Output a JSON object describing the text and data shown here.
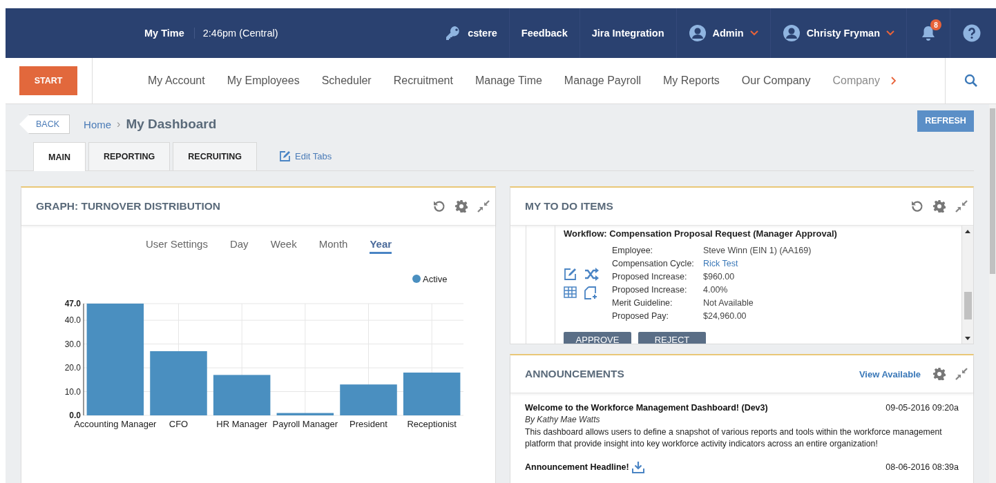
{
  "topbar": {
    "my_time_label": "My Time",
    "time": "2:46pm (Central)",
    "items": [
      {
        "kind": "key",
        "label": "cstere"
      },
      {
        "kind": "plain",
        "label": "Feedback"
      },
      {
        "kind": "plain",
        "label": "Jira Integration"
      },
      {
        "kind": "user",
        "label": "Admin"
      },
      {
        "kind": "user",
        "label": "Christy Fryman"
      }
    ],
    "notification_count": "8"
  },
  "nav": {
    "start": "START",
    "items": [
      "My Account",
      "My Employees",
      "Scheduler",
      "Recruitment",
      "Manage Time",
      "Manage Payroll",
      "My Reports",
      "Our Company",
      "Company"
    ]
  },
  "breadcrumb": {
    "back": "BACK",
    "home": "Home",
    "separator": "›",
    "current": "My Dashboard"
  },
  "refresh": "REFRESH",
  "tabs": [
    {
      "label": "MAIN",
      "selected": true
    },
    {
      "label": "REPORTING",
      "selected": false
    },
    {
      "label": "RECRUITING",
      "selected": false
    }
  ],
  "edit_tabs": "Edit Tabs",
  "turnover": {
    "title": "GRAPH: TURNOVER DISTRIBUTION",
    "periods": [
      {
        "label": "User Settings",
        "selected": false
      },
      {
        "label": "Day",
        "selected": false
      },
      {
        "label": "Week",
        "selected": false
      },
      {
        "label": "Month",
        "selected": false
      },
      {
        "label": "Year",
        "selected": true
      }
    ],
    "chart_data": {
      "type": "bar",
      "categories": [
        "Accounting Manager",
        "CFO",
        "HR Manager",
        "Payroll Manager",
        "President",
        "Receptionist"
      ],
      "series": [
        {
          "name": "Active",
          "color": "#4a8fc0",
          "values": [
            47,
            27,
            17,
            1,
            13,
            18
          ]
        }
      ],
      "ylim": [
        0,
        47
      ],
      "grid": true,
      "yticks": [
        {
          "value": 0,
          "label": "0.0"
        },
        {
          "value": 10,
          "label": "10.0"
        },
        {
          "value": 20,
          "label": "20.0"
        },
        {
          "value": 30,
          "label": "30.0"
        },
        {
          "value": 40,
          "label": "40.0"
        },
        {
          "value": 47,
          "label": "47.0"
        }
      ]
    }
  },
  "todo": {
    "title": "MY TO DO ITEMS",
    "workflow": "Workflow: Compensation Proposal Request (Manager Approval)",
    "fields": [
      {
        "label": "Employee:",
        "value": "Steve Winn (EIN 1) (AA169)",
        "kind": "text"
      },
      {
        "label": "Compensation Cycle:",
        "value": "Rick Test",
        "kind": "link"
      },
      {
        "label": "Proposed Increase:",
        "value": "$960.00",
        "kind": "text"
      },
      {
        "label": "Proposed Increase:",
        "value": "4.00%",
        "kind": "text"
      },
      {
        "label": "Merit Guideline:",
        "value": "Not Available",
        "kind": "text"
      },
      {
        "label": "Proposed Pay:",
        "value": "$24,960.00",
        "kind": "text"
      }
    ],
    "buttons": [
      "APPROVE",
      "REJECT"
    ]
  },
  "announcements": {
    "title": "ANNOUNCEMENTS",
    "view_available": "View Available",
    "items": [
      {
        "headline": "Welcome to the Workforce Management Dashboard! (Dev3)",
        "date": "09-05-2016 09:20a",
        "author": "By Kathy Mae Watts",
        "body": "This dashboard allows users to define a snapshot of various reports and tools within the workforce management platform that provide insight into key workforce activity indicators across an entire organization!",
        "kind": "text"
      },
      {
        "headline": "Announcement Headline!",
        "date": "08-06-2016 08:39a",
        "kind": "attachment"
      }
    ]
  }
}
